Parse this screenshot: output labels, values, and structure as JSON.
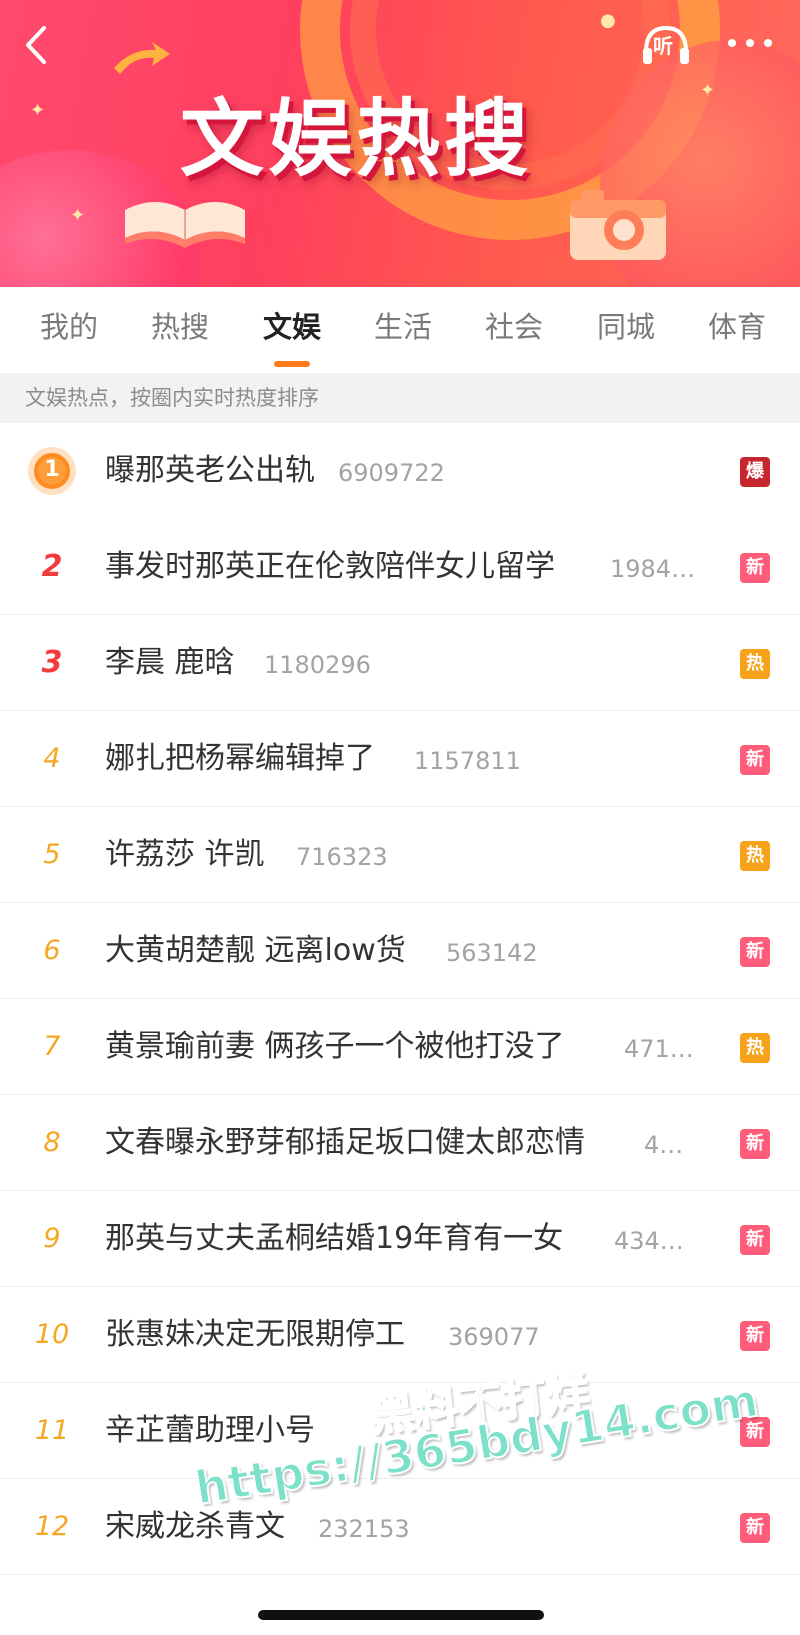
{
  "banner": {
    "title": "文娱热搜",
    "listen_label": "听"
  },
  "tabs": [
    {
      "label": "我的",
      "active": false
    },
    {
      "label": "热搜",
      "active": false
    },
    {
      "label": "文娱",
      "active": true
    },
    {
      "label": "生活",
      "active": false
    },
    {
      "label": "社会",
      "active": false
    },
    {
      "label": "同城",
      "active": false
    },
    {
      "label": "体育",
      "active": false
    }
  ],
  "subtitle": "文娱热点，按圈内实时热度排序",
  "items": [
    {
      "rank": "1",
      "title": "曝那英老公出轨",
      "count": "6909722",
      "badge": "爆",
      "badge_color": "#c6262e"
    },
    {
      "rank": "2",
      "title": "事发时那英正在伦敦陪伴女儿留学",
      "count": "1984…",
      "badge": "新",
      "badge_color": "#ff5c7a"
    },
    {
      "rank": "3",
      "title": "李晨 鹿晗",
      "count": "1180296",
      "badge": "热",
      "badge_color": "#f7a21b"
    },
    {
      "rank": "4",
      "title": "娜扎把杨幂编辑掉了",
      "count": "1157811",
      "badge": "新",
      "badge_color": "#ff5c7a"
    },
    {
      "rank": "5",
      "title": "许荔莎 许凯",
      "count": "716323",
      "badge": "热",
      "badge_color": "#f7a21b"
    },
    {
      "rank": "6",
      "title": "大黄胡楚靓 远离low货",
      "count": "563142",
      "badge": "新",
      "badge_color": "#ff5c7a"
    },
    {
      "rank": "7",
      "title": "黄景瑜前妻 俩孩子一个被他打没了",
      "count": "471…",
      "badge": "热",
      "badge_color": "#f7a21b"
    },
    {
      "rank": "8",
      "title": "文春曝永野芽郁插足坂口健太郎恋情",
      "count": "4…",
      "badge": "新",
      "badge_color": "#ff5c7a"
    },
    {
      "rank": "9",
      "title": "那英与丈夫孟桐结婚19年育有一女",
      "count": "434…",
      "badge": "新",
      "badge_color": "#ff5c7a"
    },
    {
      "rank": "10",
      "title": "张惠妹决定无限期停工",
      "count": "369077",
      "badge": "新",
      "badge_color": "#ff5c7a"
    },
    {
      "rank": "11",
      "title": "辛芷蕾助理小号",
      "count": "",
      "badge": "新",
      "badge_color": "#ff5c7a"
    },
    {
      "rank": "12",
      "title": "宋威龙杀青文",
      "count": "232153",
      "badge": "新",
      "badge_color": "#ff5c7a"
    }
  ],
  "watermark": {
    "line1": "黑料不打烊",
    "line2": "https://365bdy14.com"
  },
  "colors": {
    "accent": "#ff7a1a",
    "top_rank": "#f23b3b",
    "rank": "#f5a623"
  }
}
